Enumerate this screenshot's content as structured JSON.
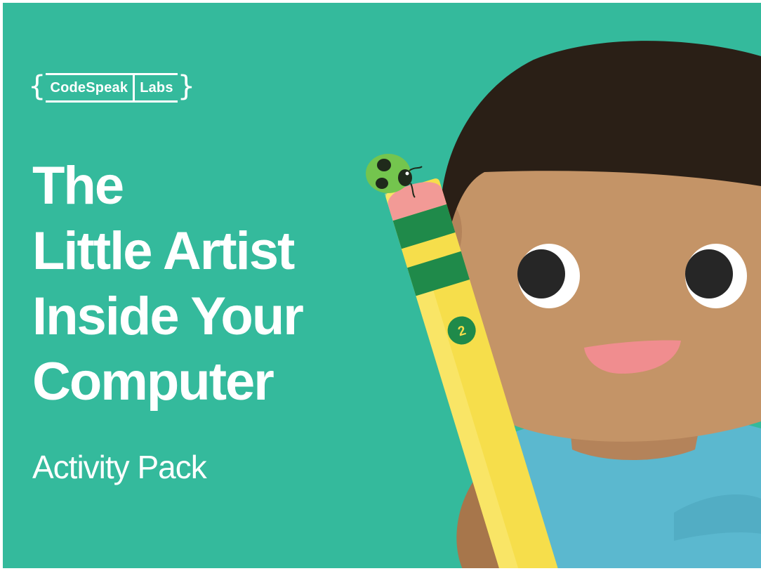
{
  "brand": {
    "name_left": "CodeSpeak",
    "name_right": "Labs"
  },
  "cover": {
    "title_lines": [
      "The",
      "Little Artist",
      "Inside Your",
      "Computer"
    ],
    "subtitle": "Activity Pack"
  },
  "illustration": {
    "pencil_number": "2",
    "icons": [
      "boy-illustration",
      "pencil-icon",
      "ladybug-icon"
    ]
  },
  "colors": {
    "background": "#34BA9C",
    "text": "#FFFFFF",
    "hair": "#2A1F16",
    "skin": "#C49467",
    "shirt": "#5BB8CF",
    "pencil_yellow": "#F6DE4B",
    "pencil_band": "#1F8A4A",
    "eraser": "#F29A96",
    "mouth": "#F08D8F"
  }
}
